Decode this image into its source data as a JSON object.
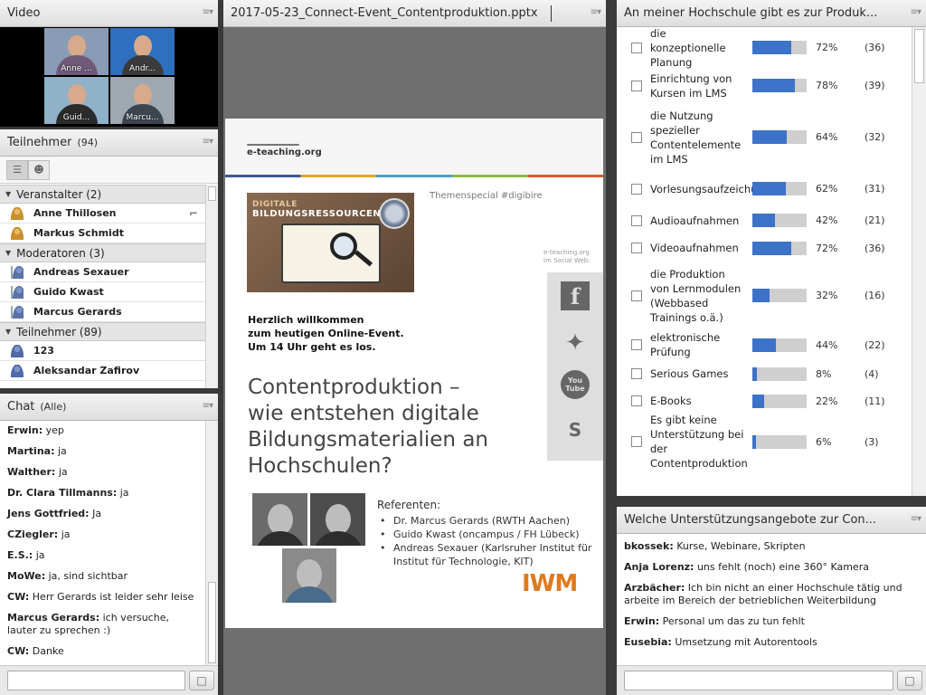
{
  "video": {
    "title": "Video",
    "participants": [
      {
        "name": "Anne ...",
        "bg": "#8a9bb5",
        "shirt": "#6f5a7a"
      },
      {
        "name": "Andr...",
        "bg": "#2f6fbf",
        "shirt": "#3b3b3b"
      },
      {
        "name": "Guid...",
        "bg": "#8fb2c9",
        "shirt": "#2b2b2b"
      },
      {
        "name": "Marcu...",
        "bg": "#9fa8b0",
        "shirt": "#3d4650"
      }
    ]
  },
  "attendees": {
    "title": "Teilnehmer",
    "count": "(94)",
    "groups": [
      {
        "label": "Veranstalter (2)",
        "role": "host",
        "members": [
          "Anne Thillosen",
          "Markus Schmidt"
        ]
      },
      {
        "label": "Moderatoren (3)",
        "role": "mod",
        "members": [
          "Andreas Sexauer",
          "Guido Kwast",
          "Marcus Gerards"
        ]
      },
      {
        "label": "Teilnehmer (89)",
        "role": "part",
        "members": [
          "123",
          "Aleksandar Zafirov"
        ]
      }
    ]
  },
  "chat": {
    "title": "Chat",
    "scope": "(Alle)",
    "messages": [
      {
        "author": "Erwin:",
        "text": "yep"
      },
      {
        "author": "Martina:",
        "text": "ja"
      },
      {
        "author": "Walther:",
        "text": "ja"
      },
      {
        "author": "Dr. Clara Tillmanns:",
        "text": "ja"
      },
      {
        "author": "Jens Gottfried:",
        "text": "Ja"
      },
      {
        "author": "CZiegler:",
        "text": "ja"
      },
      {
        "author": "E.S.:",
        "text": "ja"
      },
      {
        "author": "MoWe:",
        "text": "ja, sind sichtbar"
      },
      {
        "author": "CW:",
        "text": "Herr Gerards ist leider sehr leise"
      },
      {
        "author": "Marcus Gerards:",
        "text": "ich versuche, lauter zu sprechen :)"
      },
      {
        "author": "CW:",
        "text": "Danke"
      }
    ]
  },
  "share": {
    "title": "2017-05-23_Connect-Event_Contentproduktion.pptx",
    "slide": {
      "logo": "e-teaching.org",
      "theme": "Themenspecial #digibire",
      "image_tag1": "DIGITALE",
      "image_tag2": "BILDUNGSRESSOURCEN",
      "welcome": [
        "Herzlich willkommen",
        "zum heutigen Online-Event.",
        "Um 14 Uhr geht es los."
      ],
      "title": [
        "Contentproduktion –",
        "wie entstehen digitale",
        "Bildungsmaterialien an",
        "Hochschulen?"
      ],
      "social_caption": [
        "e-teaching.org",
        "im Social Web:"
      ],
      "social": [
        "f",
        "t",
        "You Tube",
        "S"
      ],
      "ref_title": "Referenten:",
      "refs": [
        "Dr. Marcus Gerards (RWTH Aachen)",
        "Guido Kwast (oncampus / FH Lübeck)",
        "Andreas Sexauer (Karlsruher Institut für Institut für Technologie, KIT)"
      ],
      "brand": "IWM"
    }
  },
  "poll": {
    "title": "An meiner Hochschule gibt es zur Produk...",
    "items": [
      {
        "label": "die konzeptionelle Planung",
        "pct": "72%",
        "count": "(36)",
        "value": 0.72
      },
      {
        "label": "Einrichtung von Kursen im LMS",
        "pct": "78%",
        "count": "(39)",
        "value": 0.78
      },
      {
        "label": "die Nutzung spezieller Contentelemente im LMS",
        "pct": "64%",
        "count": "(32)",
        "value": 0.64
      },
      {
        "label": "Vorlesungsaufzeichungen",
        "pct": "62%",
        "count": "(31)",
        "value": 0.62
      },
      {
        "label": "Audioaufnahmen",
        "pct": "42%",
        "count": "(21)",
        "value": 0.42
      },
      {
        "label": "Videoaufnahmen",
        "pct": "72%",
        "count": "(36)",
        "value": 0.72
      },
      {
        "label": "die Produktion von Lernmodulen (Webbased Trainings o.ä.)",
        "pct": "32%",
        "count": "(16)",
        "value": 0.32
      },
      {
        "label": "elektronische Prüfung",
        "pct": "44%",
        "count": "(22)",
        "value": 0.44
      },
      {
        "label": "Serious Games",
        "pct": "8%",
        "count": "(4)",
        "value": 0.08
      },
      {
        "label": "E-Books",
        "pct": "22%",
        "count": "(11)",
        "value": 0.22
      },
      {
        "label": "Es gibt keine Unterstützung bei der Contentproduktion",
        "pct": "6%",
        "count": "(3)",
        "value": 0.06
      }
    ]
  },
  "notes": {
    "title": "Welche Unterstützungsangebote zur Con...",
    "messages": [
      {
        "author": "bkossek:",
        "text": "Kurse, Webinare, Skripten"
      },
      {
        "author": "Anja Lorenz:",
        "text": "uns fehlt (noch) eine 360° Kamera"
      },
      {
        "author": "Arzbächer:",
        "text": "Ich bin nicht an einer Hochschule tätig und arbeite im Bereich der betrieblichen Weiterbildung"
      },
      {
        "author": "Erwin:",
        "text": "Personal um das zu tun fehlt"
      },
      {
        "author": "Eusebia:",
        "text": "Umsetzung mit Autorentools"
      }
    ]
  },
  "menu_glyph": "≡▾",
  "send_glyph": "💬"
}
